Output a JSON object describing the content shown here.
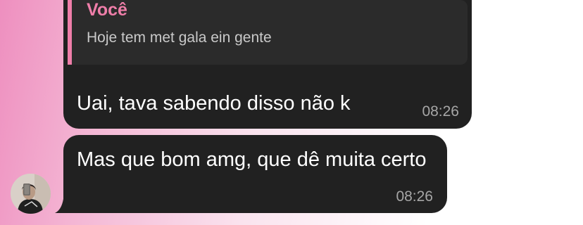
{
  "messages": [
    {
      "reply": {
        "author": "Você",
        "text": "Hoje tem met gala ein gente"
      },
      "text": "Uai, tava sabendo disso não k",
      "time": "08:26"
    },
    {
      "text": "Mas que bom amg, que dê muita certo",
      "time": "08:26"
    }
  ],
  "colors": {
    "bubble": "#212121",
    "reply_accent": "#ef7ea9",
    "timestamp": "#a6a6a6"
  },
  "icons": {
    "avatar": "contact-avatar-photo"
  }
}
